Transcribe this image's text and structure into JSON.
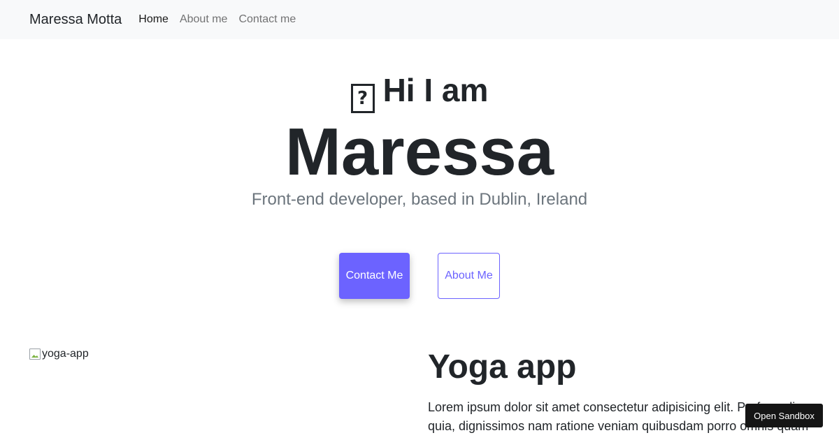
{
  "nav": {
    "brand": "Maressa Motta",
    "links": [
      "Home",
      "About me",
      "Contact me"
    ]
  },
  "hero": {
    "greeting_icon": "missing-glyph-icon",
    "greeting_text": "Hi I am",
    "name": "Maressa",
    "tagline": "Front-end developer, based in Dublin, Ireland",
    "contact_button": "Contact Me",
    "about_button": "About Me"
  },
  "project": {
    "image_alt": "yoga-app",
    "title": "Yoga app",
    "description": "Lorem ipsum dolor sit amet consectetur adipisicing elit. Perferendis quia, dignissimos nam ratione veniam quibusdam porro omnis quam"
  },
  "sandbox": {
    "label": "Open Sandbox"
  },
  "colors": {
    "accent": "#6c63ff",
    "navbar_bg": "#f8f9fa",
    "muted_text": "#6c757d",
    "sandbox_bg": "#151515"
  }
}
